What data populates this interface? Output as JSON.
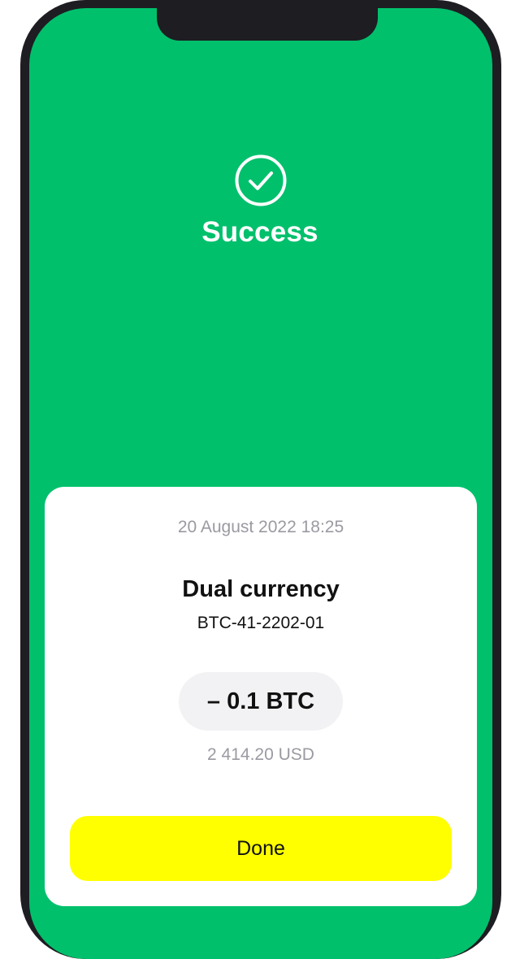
{
  "colors": {
    "screen_background": "#00c06c",
    "card_background": "#ffffff",
    "button_background": "#ffff00",
    "pill_background": "#f2f2f4",
    "muted_text": "#9a9aa2",
    "primary_text": "#111111"
  },
  "status": {
    "icon": "check-circle-icon",
    "title": "Success"
  },
  "receipt": {
    "date": "20 August 2022 18:25",
    "product_name": "Dual currency",
    "product_code": "BTC-41-2202-01",
    "amount": "– 0.1 BTC",
    "converted_amount": "2 414.20 USD"
  },
  "actions": {
    "done_label": "Done"
  }
}
